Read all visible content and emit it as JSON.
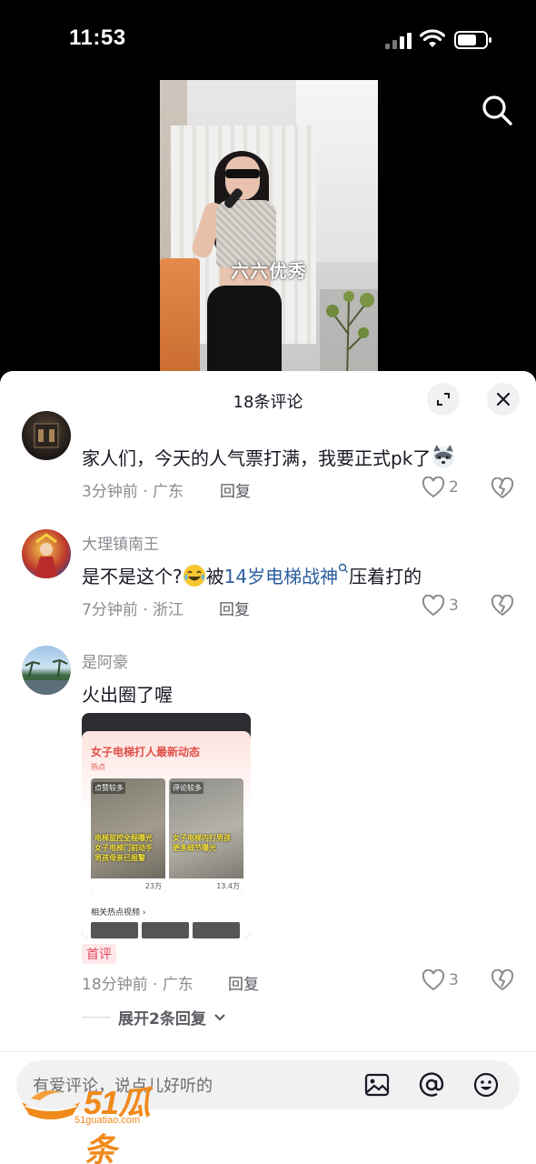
{
  "status_bar": {
    "time": "11:53"
  },
  "video": {
    "caption": "六六优秀"
  },
  "sheet": {
    "title": "18条评论"
  },
  "comments": [
    {
      "user": "",
      "text": "家人们，今天的人气票打满，我要正式pk了",
      "time_location": "3分钟前 · 广东",
      "reply_label": "回复",
      "likes": "2"
    },
    {
      "user": "大理镇南王",
      "text_before": "是不是这个?",
      "text_mid": "被",
      "topic": "14岁电梯战神",
      "text_after": "压着打的",
      "time_location": "7分钟前 · 浙江",
      "reply_label": "回复",
      "likes": "3"
    },
    {
      "user": "是阿豪",
      "text": "火出圈了喔",
      "image": {
        "title": "女子电梯打人最新动态",
        "subtitle": "热点",
        "thumb1_label": "点赞较多",
        "thumb1_overlay": "电梯监控全程曝光 女子电梯门前动手 男孩母亲已报警",
        "thumb1_likes": "23万",
        "thumb2_label": "评论较多",
        "thumb2_overlay": "女子电梯内打男孩 更多细节曝光",
        "thumb2_likes": "13.4万",
        "related": "相关热点视频 ›"
      },
      "first_tag": "首评",
      "time_location": "18分钟前 · 广东",
      "reply_label": "回复",
      "likes": "3",
      "expand_label": "展开2条回复"
    }
  ],
  "input": {
    "placeholder": "有爱评论，说点儿好听的"
  },
  "watermark": {
    "brand": "51瓜条",
    "url": "51guatiao.com"
  },
  "colors": {
    "topic_link": "#2a5d9f",
    "first_tag": "#e8495a",
    "watermark": "#f08a1c"
  }
}
